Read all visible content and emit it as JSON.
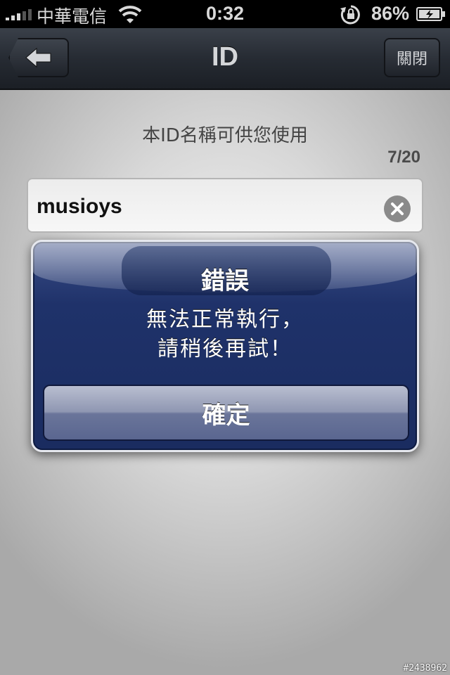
{
  "status_bar": {
    "carrier": "中華電信",
    "time": "0:32",
    "battery_percent": "86%",
    "icons": [
      "signal-icon",
      "wifi-icon",
      "rotation-lock-icon",
      "battery-charging-icon"
    ]
  },
  "nav": {
    "title": "ID",
    "close_label": "關閉",
    "back_icon": "back-arrow-icon"
  },
  "form": {
    "availability_message": "本ID名稱可供您使用",
    "char_count": "7/20",
    "id_value": "musioys",
    "clear_icon": "clear-icon"
  },
  "alert": {
    "title": "錯誤",
    "message_line1": "無法正常執行，",
    "message_line2": "請稍後再試！",
    "confirm_label": "確定"
  },
  "watermark": "#2438962",
  "colors": {
    "nav_bar": "#262b33",
    "alert_background": "#1f326a",
    "alert_border": "#e6e8ee"
  }
}
